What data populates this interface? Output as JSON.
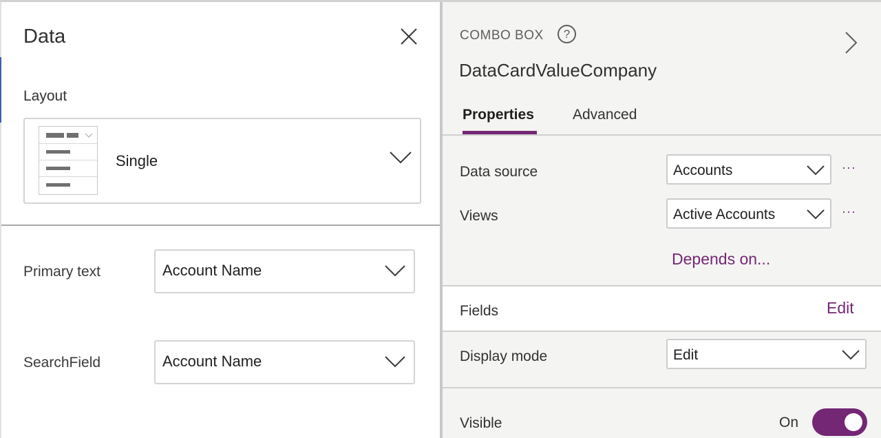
{
  "data_panel": {
    "title": "Data",
    "close_icon": "close-icon",
    "layout": {
      "label": "Layout",
      "selected": "Single"
    },
    "primary_text": {
      "label": "Primary text",
      "value": "Account Name"
    },
    "search_field": {
      "label": "SearchField",
      "value": "Account Name"
    }
  },
  "properties_panel": {
    "control_type": "COMBO BOX",
    "help_icon": "?",
    "control_name": "DataCardValueCompany",
    "tabs": [
      {
        "label": "Properties",
        "active": true
      },
      {
        "label": "Advanced",
        "active": false
      }
    ],
    "data_source": {
      "label": "Data source",
      "value": "Accounts",
      "more": "···"
    },
    "views": {
      "label": "Views",
      "value": "Active Accounts",
      "more": "···"
    },
    "depends_on": "Depends on...",
    "fields": {
      "label": "Fields",
      "action": "Edit"
    },
    "display_mode": {
      "label": "Display mode",
      "value": "Edit"
    },
    "visible": {
      "label": "Visible",
      "state_label": "On",
      "on": true
    }
  },
  "colors": {
    "accent": "#742774",
    "panel_bg": "#f4f4f3",
    "data_bg": "#ffffff"
  }
}
